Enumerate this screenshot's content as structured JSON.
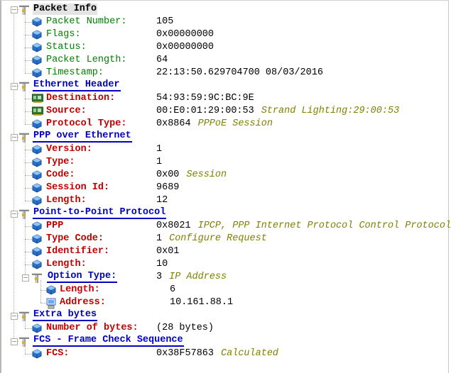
{
  "colors": {
    "header": "#0000c0",
    "green_label": "#008000",
    "red_label": "#c00000",
    "note": "#808000"
  },
  "rows": [
    {
      "level": 0,
      "label": "Packet Info",
      "icon": "protocol-icon",
      "selected": true
    },
    {
      "level": 1,
      "label": "Packet Number:",
      "value": "105",
      "style": "green",
      "icon": "field-cube-icon"
    },
    {
      "level": 1,
      "label": "Flags:",
      "value": "0x00000000",
      "style": "green",
      "icon": "field-cube-icon"
    },
    {
      "level": 1,
      "label": "Status:",
      "value": "0x00000000",
      "style": "green",
      "icon": "field-cube-icon"
    },
    {
      "level": 1,
      "label": "Packet Length:",
      "value": "64",
      "style": "green",
      "icon": "field-cube-icon"
    },
    {
      "level": 1,
      "label": "Timestamp:",
      "value": "22:13:50.629704700 08/03/2016",
      "style": "green",
      "icon": "field-cube-icon",
      "last": true
    },
    {
      "level": 0,
      "label": "Ethernet Header",
      "icon": "protocol-icon"
    },
    {
      "level": 1,
      "label": "Destination:",
      "value": "54:93:59:9C:BC:9E",
      "style": "red",
      "icon": "network-card-icon"
    },
    {
      "level": 1,
      "label": "Source:",
      "value": "00:E0:01:29:00:53",
      "note": "Strand Lighting:29:00:53",
      "style": "red",
      "icon": "network-card-icon"
    },
    {
      "level": 1,
      "label": "Protocol Type:",
      "value": "0x8864",
      "note": "PPPoE Session",
      "style": "red",
      "icon": "field-cube-icon",
      "last": true
    },
    {
      "level": 0,
      "label": "PPP over Ethernet",
      "icon": "protocol-icon"
    },
    {
      "level": 1,
      "label": "Version:",
      "value": "1",
      "style": "red",
      "icon": "field-cube-icon"
    },
    {
      "level": 1,
      "label": "Type:",
      "value": "1",
      "style": "red",
      "icon": "field-cube-icon"
    },
    {
      "level": 1,
      "label": "Code:",
      "value": "0x00",
      "note": "Session",
      "style": "red",
      "icon": "field-cube-icon"
    },
    {
      "level": 1,
      "label": "Session Id:",
      "value": "9689",
      "style": "red",
      "icon": "field-cube-icon"
    },
    {
      "level": 1,
      "label": "Length:",
      "value": "12",
      "style": "red",
      "icon": "field-cube-icon",
      "last": true
    },
    {
      "level": 0,
      "label": "Point-to-Point Protocol",
      "icon": "protocol-icon"
    },
    {
      "level": 1,
      "label": "PPP",
      "value": "0x8021",
      "note": "IPCP, PPP Internet Protocol Control Protocol",
      "style": "red",
      "icon": "field-cube-icon"
    },
    {
      "level": 1,
      "label": "Type Code:",
      "value": "1",
      "note": "Configure Request",
      "style": "red",
      "icon": "field-cube-icon"
    },
    {
      "level": 1,
      "label": "Identifier:",
      "value": "0x01",
      "style": "red",
      "icon": "field-cube-icon"
    },
    {
      "level": 1,
      "label": "Length:",
      "value": "10",
      "style": "red",
      "icon": "field-cube-icon"
    },
    {
      "level": 2,
      "label": "Option Type:",
      "value": "3",
      "note": "IP Address",
      "icon": "protocol-icon",
      "last": true
    },
    {
      "level": 3,
      "label": "Length:",
      "value": "6",
      "style": "red",
      "icon": "field-cube-icon"
    },
    {
      "level": 3,
      "label": "Address:",
      "value": "10.161.88.1",
      "style": "red",
      "icon": "computer-icon",
      "last": true
    },
    {
      "level": 0,
      "label": "Extra bytes",
      "icon": "protocol-icon"
    },
    {
      "level": 1,
      "label": "Number of bytes:",
      "value": "(28 bytes)",
      "style": "red",
      "icon": "field-cube-icon",
      "last": true
    },
    {
      "level": 0,
      "label": "FCS - Frame Check Sequence",
      "icon": "protocol-icon"
    },
    {
      "level": 1,
      "label": "FCS:",
      "value": "0x38F57863",
      "note": "Calculated",
      "style": "red",
      "icon": "field-cube-icon",
      "last": true
    }
  ]
}
